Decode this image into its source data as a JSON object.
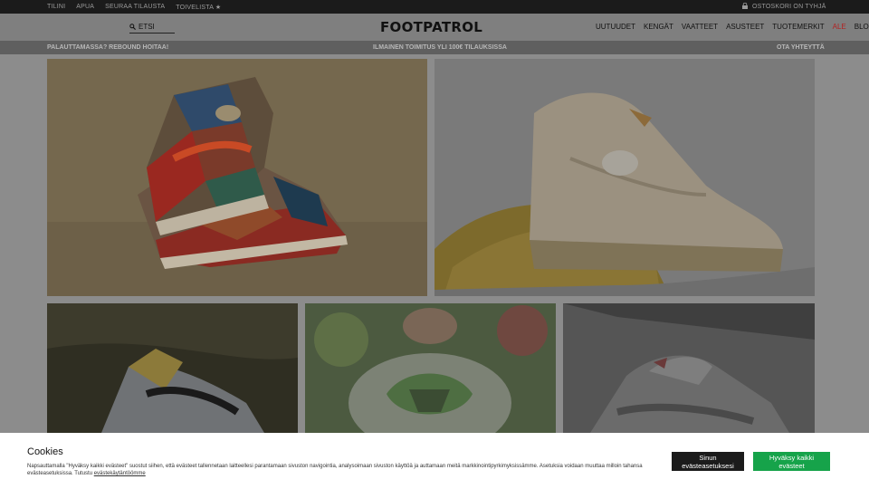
{
  "topbar": {
    "links": [
      "TILINI",
      "APUA",
      "SEURAA TILAUSTA",
      "TOIVELISTA ★"
    ],
    "cart": "OSTOSKORI ON TYHJÄ"
  },
  "header": {
    "search_placeholder": "ETSI",
    "logo": "FOOTPATROL",
    "nav": [
      "UUTUUDET",
      "KENGÄT",
      "VAATTEET",
      "ASUSTEET",
      "TUOTEMERKIT",
      "ALE",
      "BLOG"
    ]
  },
  "promo": {
    "left": "PALAUTTAMASSA? REBOUND HOITAA!",
    "center": "ILMAINEN TOIMITUS YLI 100€ TILAUKSISSA",
    "right": "OTA YHTEYTTÄ"
  },
  "colors": {
    "accent_sale": "#b22222",
    "accept_button": "#16a34a"
  },
  "cookie": {
    "title": "Cookies",
    "text": "Napsauttamalla \"Hyväksy kaikki evästeet\" suostut siihen, että evästeet tallennetaan laitteellesi parantamaan sivuston navigointia, analysoimaan sivuston käyttöä ja auttamaan meitä markkinointipyrkimyksissämme. Asetuksia voidaan muuttaa milloin tahansa evästeasetuksissa. Tutustu",
    "link": "evästekäytäntöömme",
    "settings_button": "Sinun evästeasetuksesi",
    "accept_button": "Hyväksy kaikki evästeet"
  }
}
